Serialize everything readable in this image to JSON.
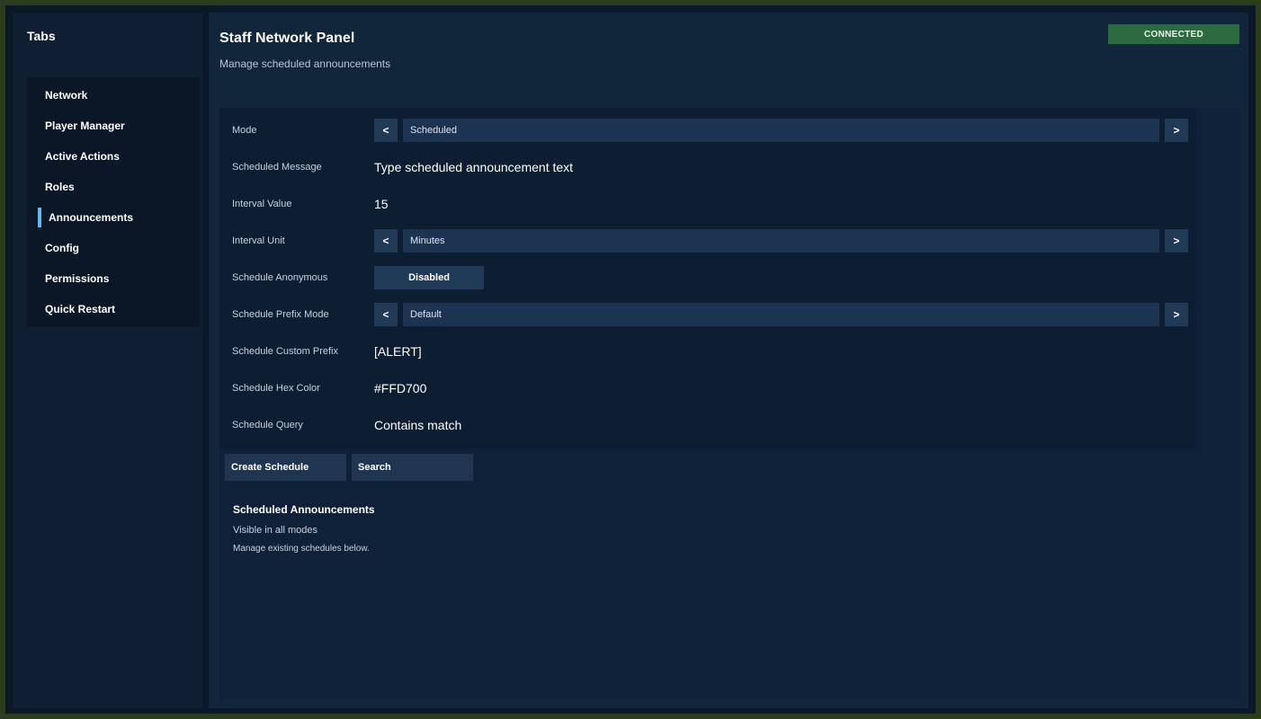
{
  "sidebar": {
    "title": "Tabs",
    "items": [
      {
        "label": "Network"
      },
      {
        "label": "Player Manager"
      },
      {
        "label": "Active Actions"
      },
      {
        "label": "Roles"
      },
      {
        "label": "Announcements",
        "active": true
      },
      {
        "label": "Config"
      },
      {
        "label": "Permissions"
      },
      {
        "label": "Quick Restart"
      }
    ]
  },
  "header": {
    "title": "Staff Network Panel",
    "subtitle": "Manage scheduled announcements",
    "status": "CONNECTED"
  },
  "form": {
    "mode": {
      "label": "Mode",
      "value": "Scheduled",
      "prev": "<",
      "next": ">"
    },
    "message": {
      "label": "Scheduled Message",
      "value": "Type scheduled announcement text"
    },
    "interval_value": {
      "label": "Interval Value",
      "value": "15"
    },
    "interval_unit": {
      "label": "Interval Unit",
      "value": "Minutes",
      "prev": "<",
      "next": ">"
    },
    "anonymous": {
      "label": "Schedule Anonymous",
      "value": "Disabled"
    },
    "prefix_mode": {
      "label": "Schedule Prefix Mode",
      "value": "Default",
      "prev": "<",
      "next": ">"
    },
    "custom_prefix": {
      "label": "Schedule Custom Prefix",
      "value": "[ALERT]"
    },
    "hex_color": {
      "label": "Schedule Hex Color",
      "value": "#FFD700"
    },
    "query": {
      "label": "Schedule Query",
      "value": "Contains match"
    }
  },
  "actions": {
    "create": "Create Schedule",
    "search": "Search"
  },
  "list": {
    "title": "Scheduled Announcements",
    "subtitle": "Visible in all modes",
    "note": "Manage existing schedules below."
  },
  "colors": {
    "accent": "#5fb8f0",
    "status_bg": "#2c6a3f",
    "background": "#0b1828"
  }
}
